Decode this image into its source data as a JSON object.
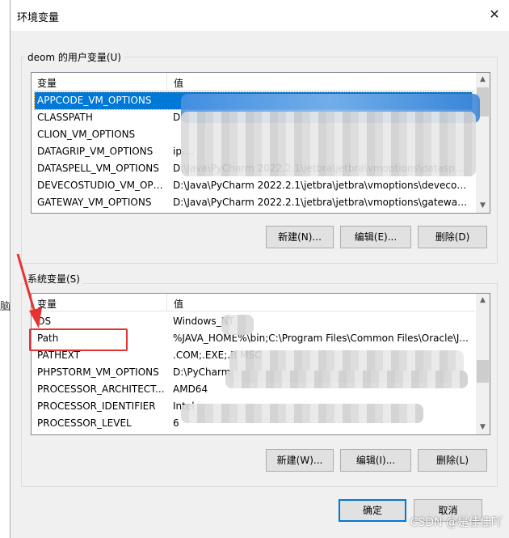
{
  "window": {
    "title": "环境变量",
    "close_icon": "close-icon"
  },
  "background_text": "脑",
  "user_vars": {
    "group_label": "deom 的用户变量(U)",
    "columns": [
      "变量",
      "值"
    ],
    "rows": [
      {
        "name": "APPCODE_VM_OPTIONS",
        "value": "",
        "selected": true
      },
      {
        "name": "CLASSPATH",
        "value": "D"
      },
      {
        "name": "CLION_VM_OPTIONS",
        "value": ""
      },
      {
        "name": "DATAGRIP_VM_OPTIONS",
        "value": "ip...."
      },
      {
        "name": "DATASPELL_VM_OPTIONS",
        "value": "D:\\Java\\PyCharm 2022.2.1\\jetbra\\jetbra\\vmoptions\\dataspell...."
      },
      {
        "name": "DEVECOSTUDIO_VM_OPT...",
        "value": "D:\\Java\\PyCharm 2022.2.1\\jetbra\\jetbra\\vmoptions\\devecost..."
      },
      {
        "name": "GATEWAY_VM_OPTIONS",
        "value": "D:\\Java\\PyCharm 2022.2.1\\jetbra\\jetbra\\vmoptions\\gateway.v..."
      }
    ],
    "buttons": {
      "new": "新建(N)...",
      "edit": "编辑(E)...",
      "delete": "删除(D)"
    }
  },
  "system_vars": {
    "group_label": "系统变量(S)",
    "columns": [
      "变量",
      "值"
    ],
    "rows": [
      {
        "name": "OS",
        "value": "Windows_NT"
      },
      {
        "name": "Path",
        "value": "%JAVA_HOME%\\bin;C:\\Program Files\\Common Files\\Oracle\\J..."
      },
      {
        "name": "PATHEXT",
        "value": ".COM;.EXE;.B                                    MSC"
      },
      {
        "name": "PHPSTORM_VM_OPTIONS",
        "value": "D:\\PyCharm"
      },
      {
        "name": "PROCESSOR_ARCHITECT...",
        "value": "AMD64"
      },
      {
        "name": "PROCESSOR_IDENTIFIER",
        "value": "Intel"
      },
      {
        "name": "PROCESSOR_LEVEL",
        "value": "6"
      }
    ],
    "buttons": {
      "new": "新建(W)...",
      "edit": "编辑(I)...",
      "delete": "删除(L)"
    }
  },
  "footer": {
    "ok": "确定",
    "cancel": "取消"
  },
  "watermark": "CSDN @是佳佳吖",
  "colors": {
    "selection": "#0078d7",
    "highlight": "#e53333"
  }
}
